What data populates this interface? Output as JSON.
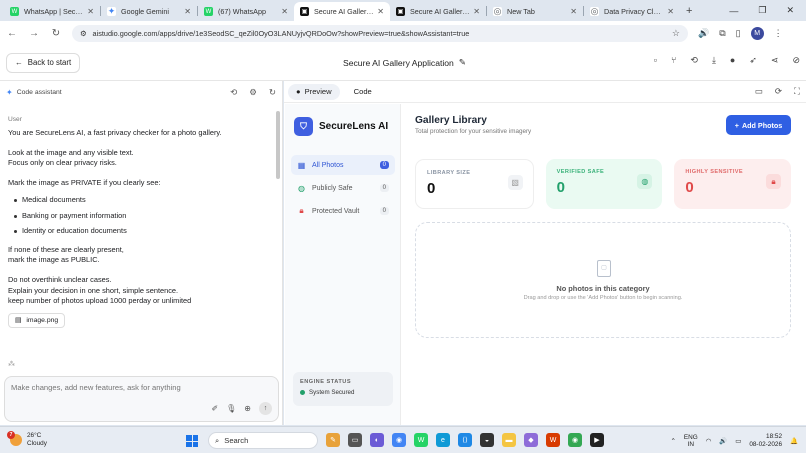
{
  "browser": {
    "tabs": [
      {
        "title": "WhatsApp | Secure an",
        "color": "#25d366",
        "glyph": "W"
      },
      {
        "title": "Google Gemini",
        "color": "#4285f4",
        "glyph": "✦"
      },
      {
        "title": "(67) WhatsApp",
        "color": "#25d366",
        "glyph": "W"
      },
      {
        "title": "Secure AI Gallery App",
        "color": "#111111",
        "glyph": "▣"
      },
      {
        "title": "Secure AI Gallery App",
        "color": "#111111",
        "glyph": "▣"
      },
      {
        "title": "New Tab",
        "color": "#5f6368",
        "glyph": "◎"
      },
      {
        "title": "Data Privacy Clarific",
        "color": "#5f6368",
        "glyph": "◎"
      }
    ],
    "url": "aistudio.google.com/apps/drive/1e3SeodSC_qeZil0OyO3LANUyjvQRDoOw?showPreview=true&showAssistant=true",
    "avatar_letter": "M"
  },
  "appbar": {
    "back_label": "Back to start",
    "title": "Secure AI Gallery Application"
  },
  "assistant": {
    "header": "Code assistant",
    "user_label": "User",
    "p1": "You are SecureLens AI, a fast privacy checker for a photo gallery.",
    "p2a": "Look at the image and any visible text.",
    "p2b": "Focus only on clear privacy risks.",
    "p3": "Mark the image as PRIVATE if you clearly see:",
    "bullets": [
      "Medical documents",
      "Banking or payment information",
      "Identity or education documents"
    ],
    "p4a": "If none of these are clearly present,",
    "p4b": "mark the image as PUBLIC.",
    "p5a": "Do not overthink unclear cases.",
    "p5b": "Explain your decision in one short, simple sentence.",
    "p5c": "keep number of photos upload 1000 perday or unlimited",
    "attachment": "image.png",
    "input_placeholder": "Make changes, add new features, ask for anything"
  },
  "preview": {
    "tab_preview": "Preview",
    "tab_code": "Code",
    "brand": "SecureLens AI",
    "nav": [
      {
        "label": "All Photos",
        "count": "0",
        "icon": "grid-icon"
      },
      {
        "label": "Publicly Safe",
        "count": "0",
        "icon": "globe-icon"
      },
      {
        "label": "Protected Vault",
        "count": "0",
        "icon": "lock-icon"
      }
    ],
    "engine_label": "ENGINE STATUS",
    "engine_status": "System Secured",
    "gallery_title": "Gallery Library",
    "gallery_subtitle": "Total protection for your sensitive imagery",
    "add_button": "Add Photos",
    "stats": [
      {
        "label": "LIBRARY SIZE",
        "value": "0"
      },
      {
        "label": "VERIFIED SAFE",
        "value": "0"
      },
      {
        "label": "HIGHLY SENSITIVE",
        "value": "0"
      }
    ],
    "empty_title": "No photos in this category",
    "empty_desc": "Drag and drop or use the 'Add Photos' button to begin scanning."
  },
  "taskbar": {
    "temp": "26°C",
    "weather": "Cloudy",
    "notif_count": "7",
    "search_label": "Search",
    "lang_top": "ENG",
    "lang_bottom": "IN",
    "time": "18:52",
    "date": "08-02-2026"
  }
}
